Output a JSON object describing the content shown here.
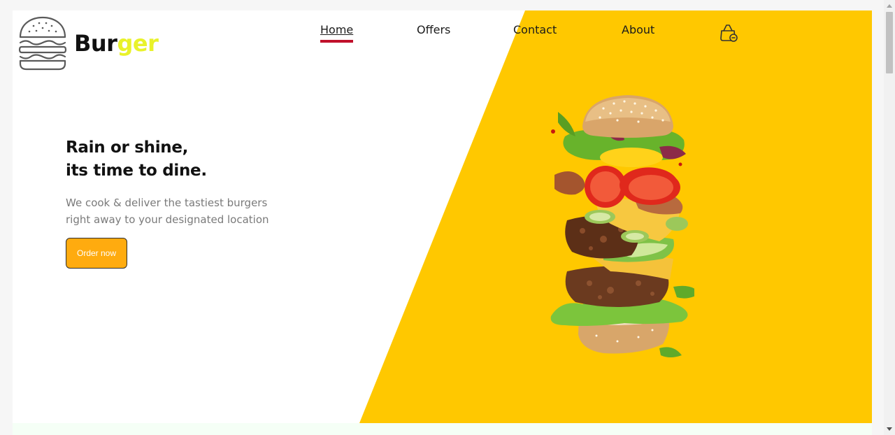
{
  "logo": {
    "text_part1": "Bur",
    "text_part2": "ger",
    "icon": "burger-outline-icon",
    "accent_color": "#e9f22a"
  },
  "nav": {
    "items": [
      {
        "label": "Home",
        "active": true
      },
      {
        "label": "Offers",
        "active": false
      },
      {
        "label": "Contact",
        "active": false
      },
      {
        "label": "About",
        "active": false
      }
    ],
    "cart_icon": "shopping-bag-icon",
    "active_underline_color": "#c0102b"
  },
  "hero": {
    "title_line1": "Rain or shine,",
    "title_line2": "its time to dine.",
    "subtitle_line1": "We cook & deliver the tastiest burgers",
    "subtitle_line2": "right away to your designated location",
    "cta_label": "Order now",
    "cta_color": "#ffab0f",
    "panel_color": "#ffc800",
    "image": "stacked-burger-image"
  }
}
